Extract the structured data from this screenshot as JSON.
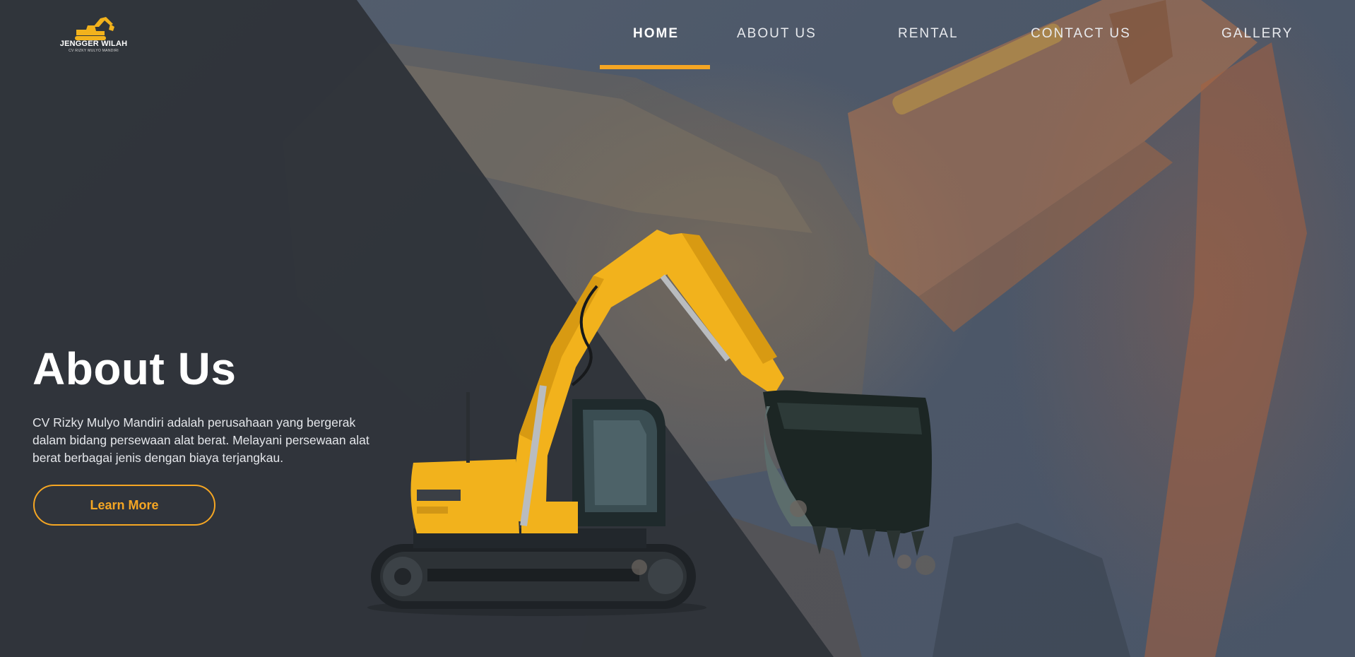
{
  "brand": {
    "name": "JENGGER WILAH",
    "subtitle": "CV RIZKY MULYO MANDIRI",
    "accent_color": "#f5a623",
    "logo_icon": "excavator-icon"
  },
  "nav": {
    "items": [
      {
        "label": "HOME",
        "active": true
      },
      {
        "label": "ABOUT US",
        "active": false
      },
      {
        "label": "RENTAL",
        "active": false
      },
      {
        "label": "CONTACT US",
        "active": false
      },
      {
        "label": "GALLERY",
        "active": false
      }
    ]
  },
  "hero": {
    "title": "About Us",
    "description": "CV Rizky Mulyo Mandiri adalah perusahaan yang bergerak dalam bidang persewaan alat berat.  Melayani persewaan alat berat berbagai jenis dengan biaya terjangkau.",
    "cta_label": "Learn More",
    "image": "yellow-excavator"
  },
  "colors": {
    "dark_panel": "#2f3339",
    "background": "#4a5568",
    "excavator_yellow": "#f2b21c"
  }
}
